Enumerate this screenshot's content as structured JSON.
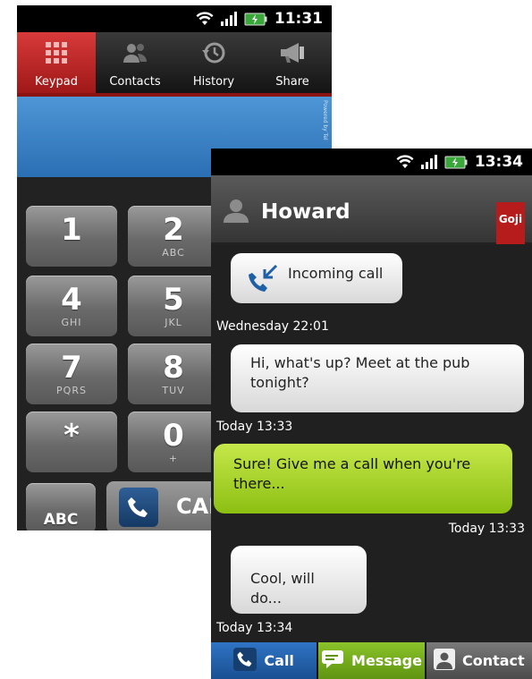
{
  "back_phone": {
    "status": {
      "time": "11:31"
    },
    "tabs": [
      {
        "label": "Keypad",
        "icon": "keypad-icon",
        "active": true
      },
      {
        "label": "Contacts",
        "icon": "contacts-icon",
        "active": false
      },
      {
        "label": "History",
        "icon": "history-icon",
        "active": false
      },
      {
        "label": "Share",
        "icon": "megaphone-icon",
        "active": false
      }
    ],
    "powered_by": "Powered by Tel",
    "keys": [
      {
        "digit": "1",
        "letters": ""
      },
      {
        "digit": "2",
        "letters": "ABC"
      },
      {
        "digit": "4",
        "letters": "GHI"
      },
      {
        "digit": "5",
        "letters": "JKL"
      },
      {
        "digit": "7",
        "letters": "PQRS"
      },
      {
        "digit": "8",
        "letters": "TUV"
      },
      {
        "digit": "*",
        "letters": ""
      },
      {
        "digit": "0",
        "letters": "+"
      }
    ],
    "abc_key": "ABC",
    "call_key": "CAL"
  },
  "front_phone": {
    "status": {
      "time": "13:34"
    },
    "contact_name": "Howard",
    "badge": "Goji",
    "messages": [
      {
        "text": "Incoming call",
        "timestamp": "Wednesday 22:01"
      },
      {
        "text": "Hi, what's up? Meet at the pub tonight?",
        "timestamp": "Today 13:33"
      },
      {
        "text": "Sure! Give me a call when you're there...",
        "timestamp": "Today 13:33"
      },
      {
        "text": "Cool, will do...",
        "timestamp": "Today 13:34"
      }
    ],
    "actions": {
      "call": "Call",
      "message": "Message",
      "contact": "Contact"
    }
  },
  "colors": {
    "keypad_tab_active": "#c62828",
    "number_display": "#3f86c9",
    "green_bubble": "#a8d52e",
    "call_button": "#2a67b2",
    "message_button": "#76ad1c",
    "contact_button": "#6a6a6a"
  }
}
